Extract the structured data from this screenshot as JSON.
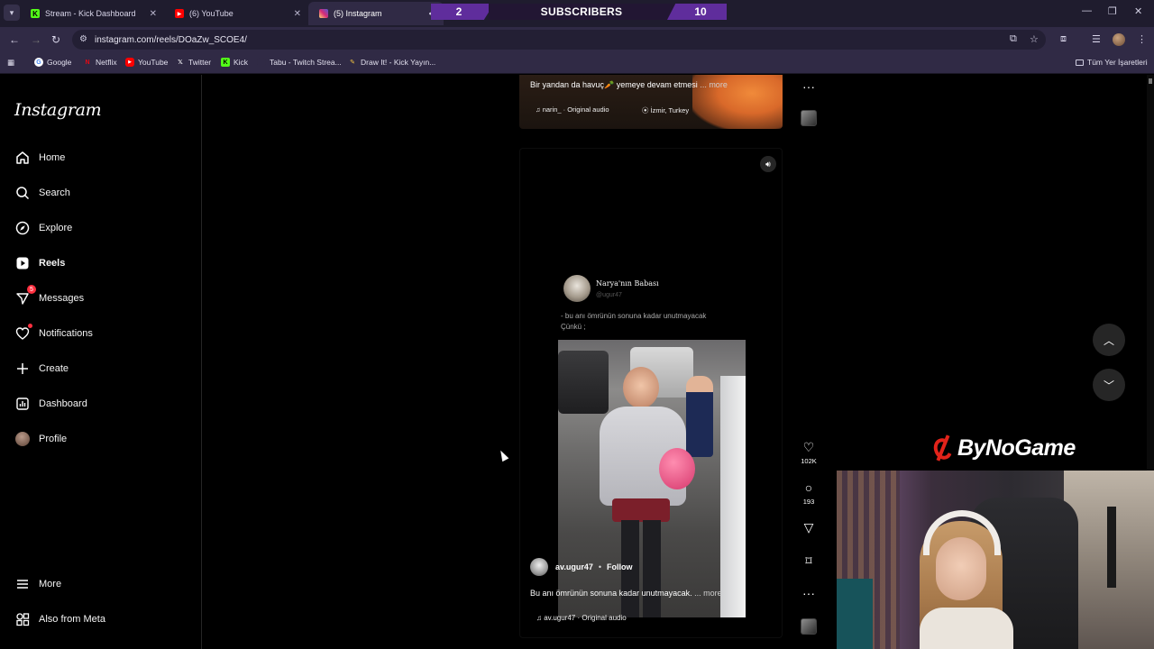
{
  "browser": {
    "tabs": [
      {
        "title": "Stream - Kick Dashboard",
        "icon": "kick-icon",
        "color": "#53fc18"
      },
      {
        "title": "(6) YouTube",
        "icon": "youtube-icon",
        "color": "#ff0000"
      },
      {
        "title": "(5) Instagram",
        "icon": "instagram-icon",
        "color": "#e1306c"
      }
    ],
    "url": "instagram.com/reels/DOaZw_SCOE4/",
    "bookmarks": [
      {
        "label": "Google",
        "icon": "google-icon"
      },
      {
        "label": "Netflix",
        "icon": "netflix-icon"
      },
      {
        "label": "YouTube",
        "icon": "youtube-icon"
      },
      {
        "label": "Twitter",
        "icon": "x-icon"
      },
      {
        "label": "Kick",
        "icon": "kick-icon"
      },
      {
        "label": "Tabu - Twitch Strea...",
        "icon": "twitch-icon"
      },
      {
        "label": "Draw It! - Kick Yayın...",
        "icon": "draw-icon"
      }
    ],
    "all_bookmarks": "Tüm Yer İşaretleri"
  },
  "stream_overlay": {
    "left_value": "2",
    "label": "SUBSCRIBERS",
    "right_value": "10",
    "sponsor": "ByNoGame"
  },
  "sidebar": {
    "logo": "Instagram",
    "items": [
      {
        "label": "Home",
        "icon": "home-icon"
      },
      {
        "label": "Search",
        "icon": "search-icon"
      },
      {
        "label": "Explore",
        "icon": "compass-icon"
      },
      {
        "label": "Reels",
        "icon": "reels-icon"
      },
      {
        "label": "Messages",
        "icon": "messenger-icon",
        "badge": "5"
      },
      {
        "label": "Notifications",
        "icon": "heart-icon"
      },
      {
        "label": "Create",
        "icon": "plus-icon"
      },
      {
        "label": "Dashboard",
        "icon": "dashboard-icon"
      },
      {
        "label": "Profile",
        "icon": "avatar"
      }
    ],
    "more": "More",
    "also_from_meta": "Also from Meta"
  },
  "previous_reel": {
    "caption": "Bir yandan da havuç🥕 yemeye devam etmesi",
    "more": "... more",
    "audio": "narin_ · Original audio",
    "location": "İzmir, Turkey"
  },
  "reel": {
    "tweet": {
      "name": "Narya'nın Babası",
      "handle": "@ugur47",
      "line1": "- bu anı ömrünün sonuna kadar unutmayacak",
      "line2": "Çünkü ;"
    },
    "username": "av.ugur47",
    "follow": "Follow",
    "caption": "Bu anı ömrünün sonuna kadar unutmayacak.",
    "more": "... more",
    "audio": "av.ugur47 · Original audio",
    "likes": "102K",
    "comments": "193"
  }
}
